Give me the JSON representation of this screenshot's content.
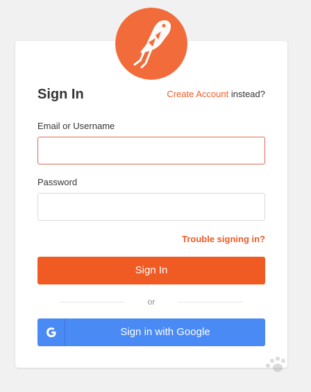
{
  "header": {
    "title": "Sign In",
    "create_account_link": "Create Account",
    "create_account_suffix": "instead?"
  },
  "form": {
    "email_label": "Email or Username",
    "email_value": "",
    "password_label": "Password",
    "password_value": "",
    "trouble_link": "Trouble signing in?",
    "submit_label": "Sign In"
  },
  "divider": {
    "text": "or"
  },
  "google": {
    "label": "Sign in with Google",
    "icon": "google-g-icon"
  },
  "logo": {
    "icon": "postman-logo",
    "color": "#f26b3a"
  },
  "colors": {
    "accent": "#f05a23",
    "link": "#ef5b25",
    "google": "#4a8af4",
    "background": "#f1f1f1"
  }
}
